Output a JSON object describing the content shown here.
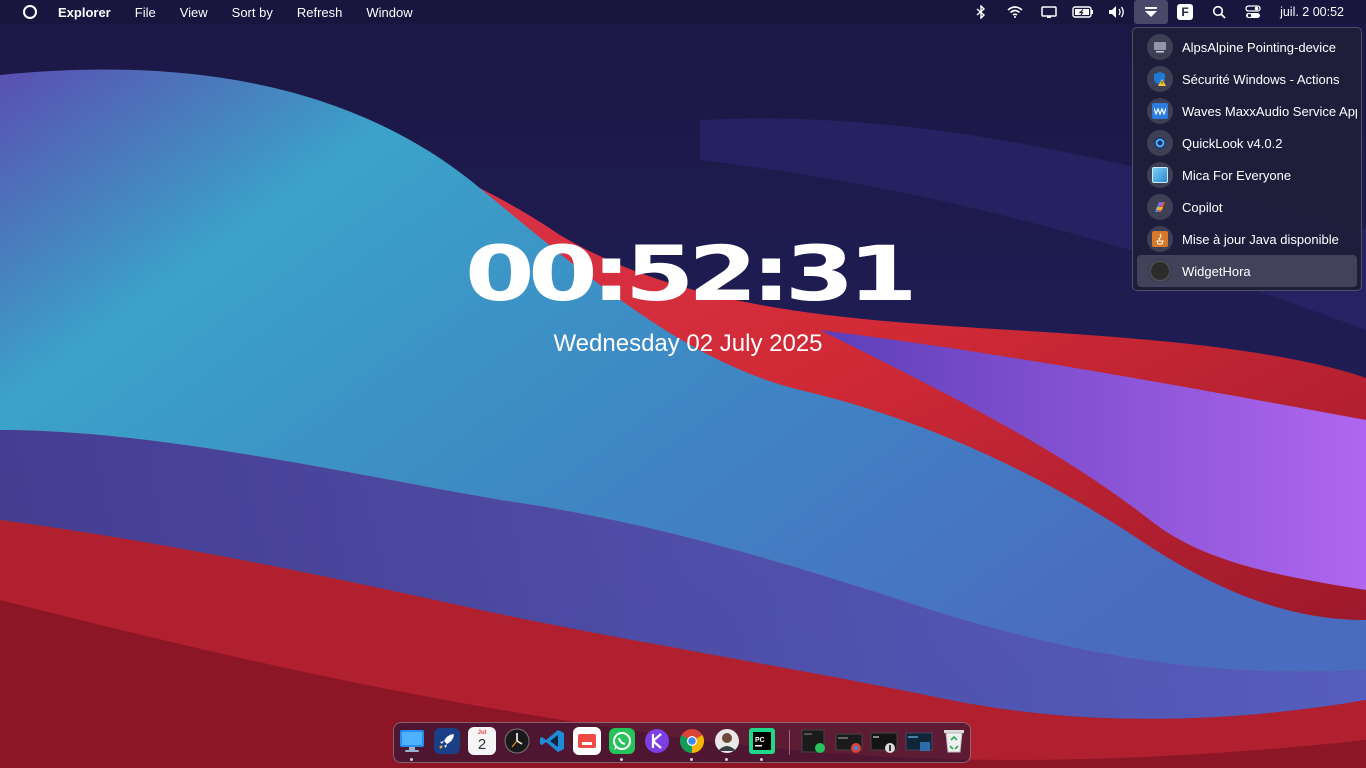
{
  "menubar": {
    "app_name": "Explorer",
    "menus": [
      "File",
      "View",
      "Sort by",
      "Refresh",
      "Window"
    ],
    "clock": "juil. 2 00:52",
    "tray_icons": [
      "bluetooth-icon",
      "wifi-icon",
      "display-icon",
      "battery-icon",
      "volume-icon",
      "tray-overflow-icon",
      "f-app-icon",
      "search-icon",
      "control-center-icon"
    ]
  },
  "tray_menu": {
    "items": [
      {
        "label": "AlpsAlpine Pointing-device",
        "icon": "alps-pointing-icon"
      },
      {
        "label": "Sécurité Windows - Actions",
        "icon": "windows-security-icon"
      },
      {
        "label": "Waves MaxxAudio Service Appl",
        "icon": "waves-audio-icon"
      },
      {
        "label": "QuickLook v4.0.2",
        "icon": "quicklook-icon"
      },
      {
        "label": "Mica For Everyone",
        "icon": "mica-icon"
      },
      {
        "label": "Copilot",
        "icon": "copilot-icon"
      },
      {
        "label": "Mise à jour Java disponible",
        "icon": "java-update-icon"
      },
      {
        "label": "WidgetHora",
        "icon": "widgethora-icon"
      }
    ],
    "hovered_index": 7
  },
  "widget": {
    "time": "00:52:31",
    "date": "Wednesday 02 July 2025"
  },
  "dock": {
    "calendar_month": "Jul",
    "calendar_day": "2",
    "apps": [
      "finder-icon",
      "launchpad-rocket-icon",
      "calendar-icon",
      "clock-icon",
      "vscode-icon",
      "screen-recorder-icon",
      "whatsapp-icon",
      "kotlin-app-icon",
      "chrome-icon",
      "avatar-app-icon",
      "pycharm-icon"
    ],
    "windows": [
      "whatsapp-window-thumbnail",
      "chrome-window-thumbnail",
      "chrome-window-thumbnail-2",
      "terminal-window-thumbnail",
      "explorer-window-thumbnail"
    ],
    "trash": "recycle-bin-icon"
  },
  "colors": {
    "wallpaper_base": "#1c1a4a",
    "wave_teal": "#3aa6c8",
    "wave_red": "#d2283a",
    "wave_purple": "#9b59e8",
    "menu_bg": "#1e1e3a"
  }
}
